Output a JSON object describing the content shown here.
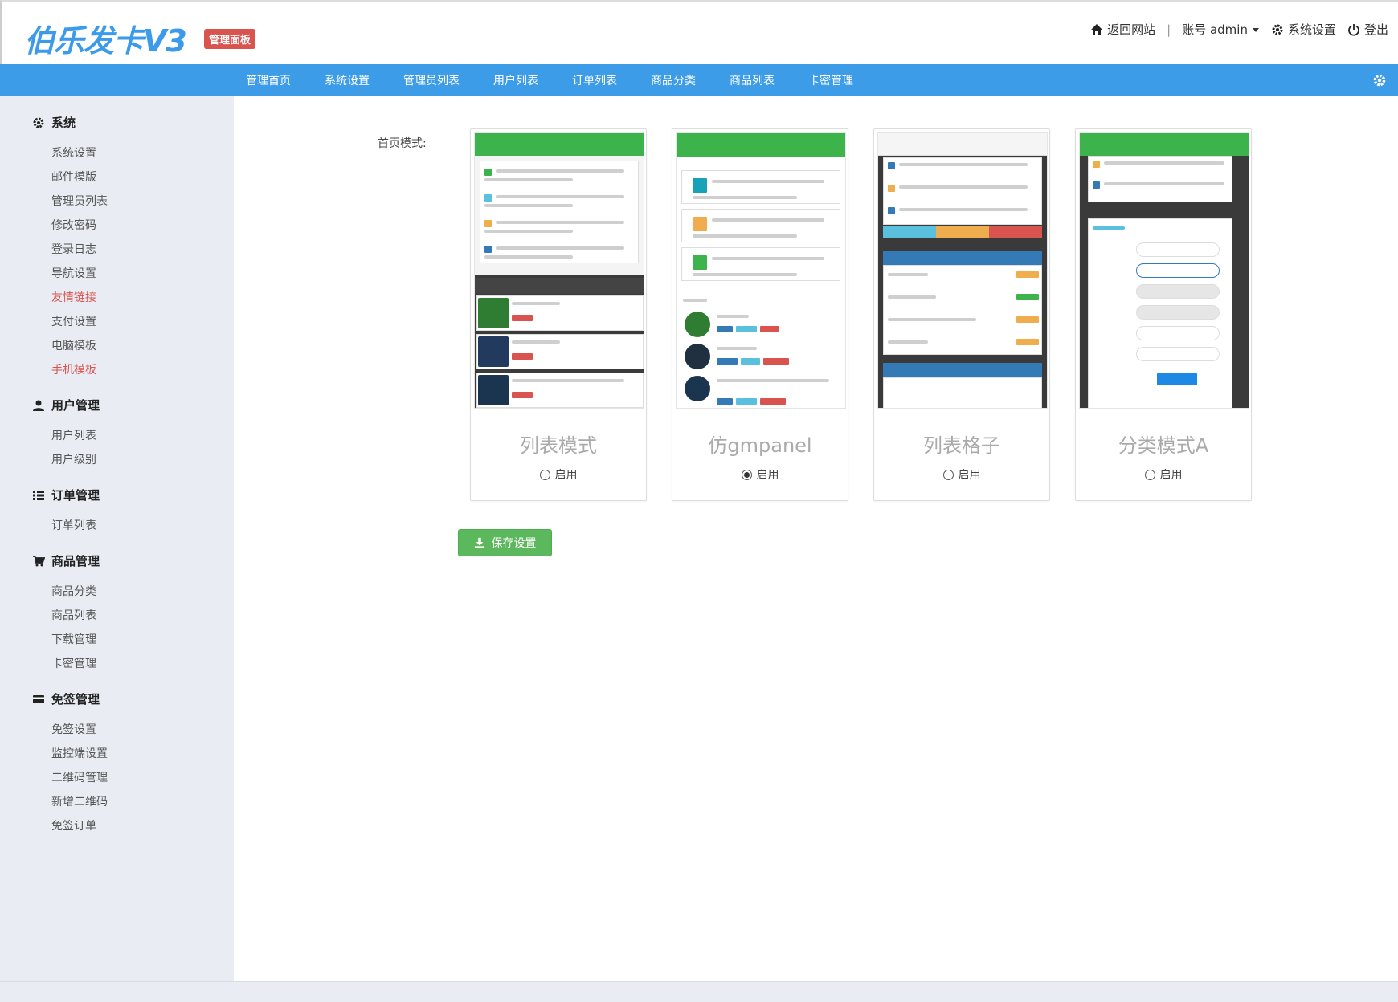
{
  "header": {
    "logo": "伯乐发卡V3",
    "badge": "管理面板",
    "back_site": "返回网站",
    "separator": "|",
    "account": "账号 admin",
    "settings": "系统设置",
    "logout": "登出"
  },
  "nav": {
    "items": [
      "管理首页",
      "系统设置",
      "管理员列表",
      "用户列表",
      "订单列表",
      "商品分类",
      "商品列表",
      "卡密管理"
    ]
  },
  "sidebar": {
    "groups": [
      {
        "title": "系统",
        "icon": "gear-icon",
        "items": [
          "系统设置",
          "邮件模版",
          "管理员列表",
          "修改密码",
          "登录日志",
          "导航设置",
          "友情链接",
          "支付设置",
          "电脑模板",
          "手机模板"
        ]
      },
      {
        "title": "用户管理",
        "icon": "user-icon",
        "items": [
          "用户列表",
          "用户级别"
        ]
      },
      {
        "title": "订单管理",
        "icon": "list-icon",
        "items": [
          "订单列表"
        ]
      },
      {
        "title": "商品管理",
        "icon": "cart-icon",
        "items": [
          "商品分类",
          "商品列表",
          "下载管理",
          "卡密管理"
        ]
      },
      {
        "title": "免签管理",
        "icon": "card-icon",
        "items": [
          "免签设置",
          "监控端设置",
          "二维码管理",
          "新增二维码",
          "免签订单"
        ]
      }
    ],
    "active_items": [
      "友情链接",
      "手机模板"
    ]
  },
  "main": {
    "label": "首页模式:",
    "modes": [
      {
        "title": "列表模式",
        "radio_label": "启用",
        "selected": false
      },
      {
        "title": "仿gmpanel",
        "radio_label": "启用",
        "selected": true
      },
      {
        "title": "列表格子",
        "radio_label": "启用",
        "selected": false
      },
      {
        "title": "分类模式A",
        "radio_label": "启用",
        "selected": false
      }
    ],
    "save_button": "保存设置"
  },
  "colors": {
    "brand_blue": "#3d9ce8",
    "sidebar_bg": "#e9ecf3",
    "active_red": "#d9534f",
    "save_green": "#5cb85c",
    "preview_green": "#3cb44b"
  }
}
